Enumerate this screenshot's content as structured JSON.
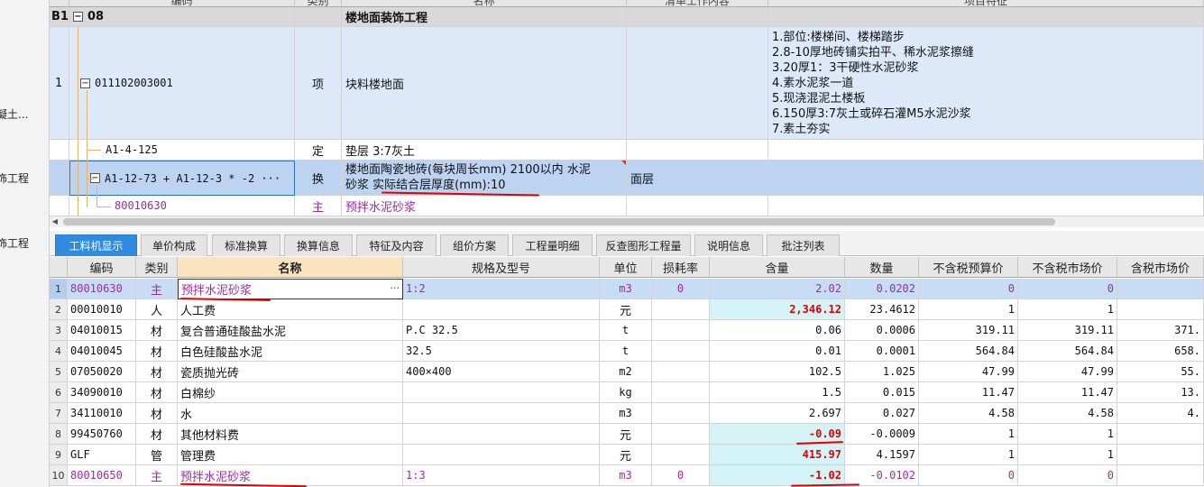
{
  "leftnav": {
    "items": [
      "凝土...",
      "饰工程",
      "饰工程"
    ]
  },
  "upper_grid": {
    "headers": [
      "编码",
      "类别",
      "名称",
      "清单工作内容",
      "项目特征"
    ],
    "section": {
      "id": "B1",
      "code": "08",
      "name": "楼地面装饰工程"
    },
    "rows": [
      {
        "num": "1",
        "code": "011102003001",
        "category": "项",
        "name": "块料楼地面",
        "work": "",
        "features": [
          "1.部位:楼梯间、楼梯踏步",
          "2.8-10厚地砖铺实拍平、稀水泥浆擦缝",
          "3.20厚1：3干硬性水泥砂浆",
          "4.素水泥浆一道",
          "5.现浇混泥土楼板",
          "6.150厚3:7灰土或碎石灌M5水泥沙浆",
          "7.素土夯实"
        ]
      },
      {
        "num": "",
        "code": "A1-4-125",
        "category": "定",
        "name": "垫层 3:7灰土",
        "work": "",
        "features": []
      },
      {
        "num": "",
        "code": "A1-12-73 + A1-12-3 * -2 ···",
        "category": "换",
        "name_line1": "楼地面陶瓷地砖(每块周长mm) 2100以内 水泥",
        "name_line2": "砂浆  实际结合层厚度(mm):10",
        "work": "面层",
        "features": []
      },
      {
        "num": "",
        "code": "80010630",
        "category": "主",
        "name": "预拌水泥砂浆",
        "work": "",
        "features": []
      }
    ]
  },
  "tabs": [
    "工料机显示",
    "单价构成",
    "标准换算",
    "换算信息",
    "特征及内容",
    "组价方案",
    "工程量明细",
    "反查图形工程量",
    "说明信息",
    "批注列表"
  ],
  "lower_grid": {
    "headers": [
      "编码",
      "类别",
      "名称",
      "规格及型号",
      "单位",
      "损耗率",
      "含量",
      "数量",
      "不含税预算价",
      "不含税市场价",
      "含税市场价"
    ],
    "rows": [
      {
        "n": "1",
        "code": "80010630",
        "cat": "主",
        "name": "预拌水泥砂浆",
        "spec": "1:2",
        "unit": "m3",
        "loss": "0",
        "qty": "2.02",
        "amount": "0.0202",
        "budget": "0",
        "market": "0",
        "tax_market": "",
        "style": "purple"
      },
      {
        "n": "2",
        "code": "00010010",
        "cat": "人",
        "name": "人工费",
        "spec": "",
        "unit": "元",
        "loss": "",
        "qty": "2,346.12",
        "amount": "23.4612",
        "budget": "1",
        "market": "1",
        "tax_market": "",
        "style": ""
      },
      {
        "n": "3",
        "code": "04010015",
        "cat": "材",
        "name": "复合普通硅酸盐水泥",
        "spec": "P.C 32.5",
        "unit": "t",
        "loss": "",
        "qty": "0.06",
        "amount": "0.0006",
        "budget": "319.11",
        "market": "319.11",
        "tax_market": "371.",
        "style": ""
      },
      {
        "n": "4",
        "code": "04010045",
        "cat": "材",
        "name": "白色硅酸盐水泥",
        "spec": "32.5",
        "unit": "t",
        "loss": "",
        "qty": "0.01",
        "amount": "0.0001",
        "budget": "564.84",
        "market": "564.84",
        "tax_market": "658.",
        "style": ""
      },
      {
        "n": "5",
        "code": "07050020",
        "cat": "材",
        "name": "瓷质抛光砖",
        "spec": "400×400",
        "unit": "m2",
        "loss": "",
        "qty": "102.5",
        "amount": "1.025",
        "budget": "47.99",
        "market": "47.99",
        "tax_market": "55.",
        "style": ""
      },
      {
        "n": "6",
        "code": "34090010",
        "cat": "材",
        "name": "白棉纱",
        "spec": "",
        "unit": "kg",
        "loss": "",
        "qty": "1.5",
        "amount": "0.015",
        "budget": "11.47",
        "market": "11.47",
        "tax_market": "13.",
        "style": ""
      },
      {
        "n": "7",
        "code": "34110010",
        "cat": "材",
        "name": "水",
        "spec": "",
        "unit": "m3",
        "loss": "",
        "qty": "2.697",
        "amount": "0.027",
        "budget": "4.58",
        "market": "4.58",
        "tax_market": "4.",
        "style": ""
      },
      {
        "n": "8",
        "code": "99450760",
        "cat": "材",
        "name": "其他材料费",
        "spec": "",
        "unit": "元",
        "loss": "",
        "qty": "-0.09",
        "amount": "-0.0009",
        "budget": "1",
        "market": "1",
        "tax_market": "",
        "style": ""
      },
      {
        "n": "9",
        "code": "GLF",
        "cat": "管",
        "name": "管理费",
        "spec": "",
        "unit": "元",
        "loss": "",
        "qty": "415.97",
        "amount": "4.1597",
        "budget": "1",
        "market": "1",
        "tax_market": "",
        "style": ""
      },
      {
        "n": "10",
        "code": "80010650",
        "cat": "主",
        "name": "预拌水泥砂浆",
        "spec": "1:3",
        "unit": "m3",
        "loss": "0",
        "qty": "-1.02",
        "amount": "-0.0102",
        "budget": "0",
        "market": "0",
        "tax_market": "",
        "style": "purple"
      }
    ]
  },
  "colors": {
    "accent_tab": "#2e8be0",
    "selected_row": "#c9dcf5",
    "main_material": "#9a2ca0",
    "annotation_red": "#e00000",
    "quantity_cyan": "#d3f3f6"
  }
}
